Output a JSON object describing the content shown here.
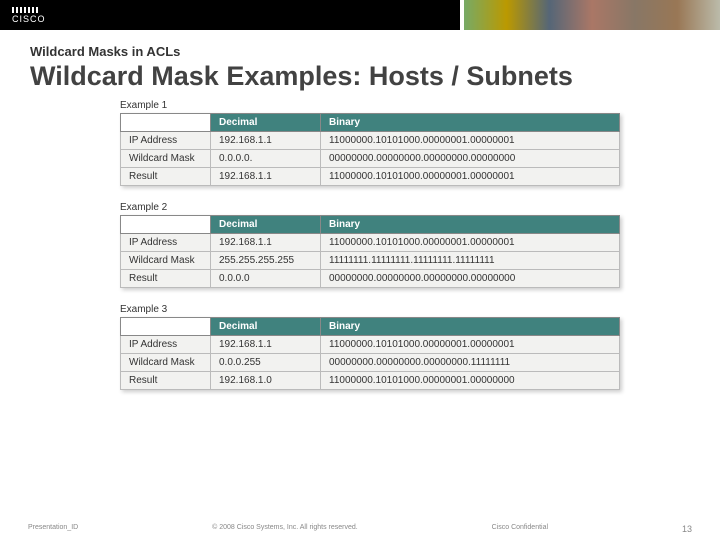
{
  "header": {
    "logo_text": "CISCO"
  },
  "section_label": "Wildcard Masks in ACLs",
  "title": "Wildcard Mask Examples: Hosts / Subnets",
  "col_headers": {
    "c1": "",
    "c2": "Decimal",
    "c3": "Binary"
  },
  "row_labels": {
    "ip": "IP Address",
    "mask": "Wildcard Mask",
    "result": "Result"
  },
  "examples": [
    {
      "label": "Example 1",
      "ip": {
        "dec": "192.168.1.1",
        "bin": "11000000.10101000.00000001.00000001"
      },
      "mask": {
        "dec": "0.0.0.0.",
        "bin": "00000000.00000000.00000000.00000000"
      },
      "result": {
        "dec": "192.168.1.1",
        "bin": "11000000.10101000.00000001.00000001"
      }
    },
    {
      "label": "Example 2",
      "ip": {
        "dec": "192.168.1.1",
        "bin": "11000000.10101000.00000001.00000001"
      },
      "mask": {
        "dec": "255.255.255.255",
        "bin": "11111111.11111111.11111111.11111111"
      },
      "result": {
        "dec": "0.0.0.0",
        "bin": "00000000.00000000.00000000.00000000"
      }
    },
    {
      "label": "Example 3",
      "ip": {
        "dec": "192.168.1.1",
        "bin": "11000000.10101000.00000001.00000001"
      },
      "mask": {
        "dec": "0.0.0.255",
        "bin": "00000000.00000000.00000000.11111111"
      },
      "result": {
        "dec": "192.168.1.0",
        "bin": "11000000.10101000.00000001.00000000"
      }
    }
  ],
  "footer": {
    "left": "Presentation_ID",
    "center": "© 2008 Cisco Systems, Inc. All rights reserved.",
    "right": "Cisco Confidential",
    "page": "13"
  }
}
